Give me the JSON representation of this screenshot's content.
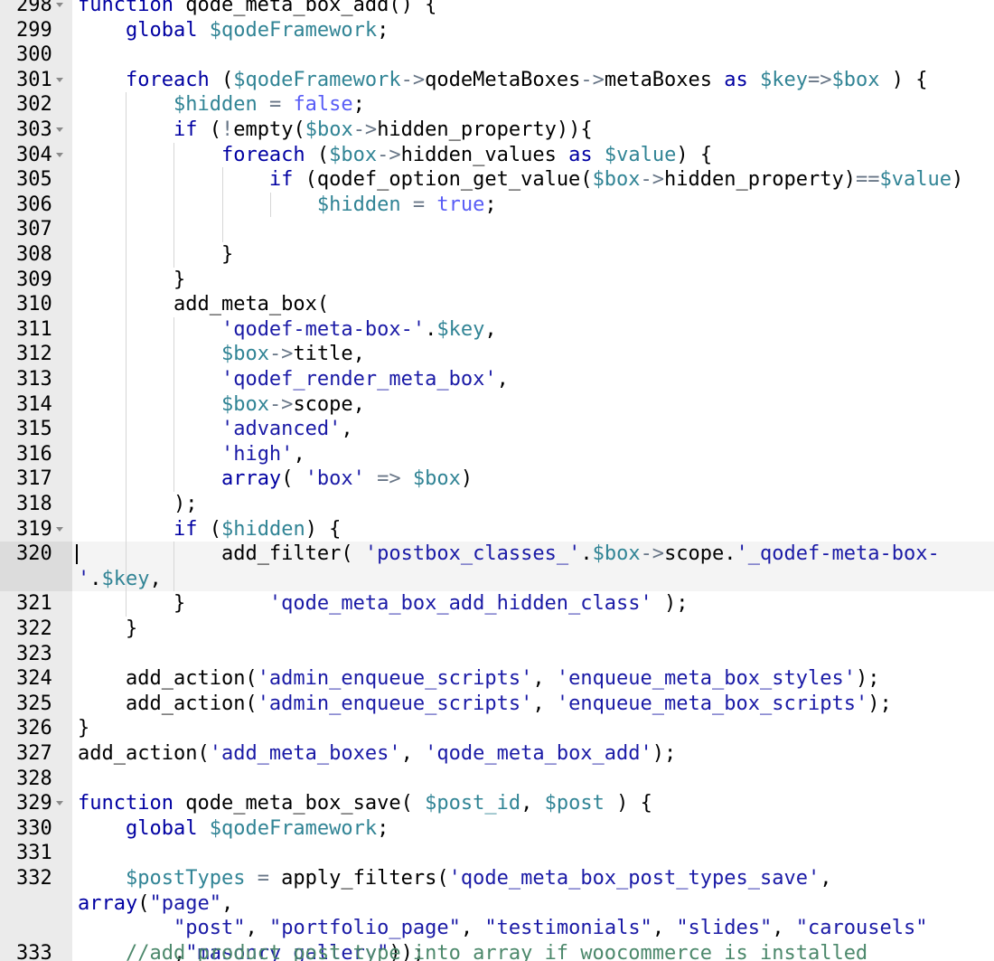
{
  "editor": {
    "colors": {
      "keyword": "#0000a2",
      "variable": "#318495",
      "string": "#1a1aa6",
      "comment": "#4c886b",
      "language_constant": "#585cf6",
      "operator": "#687687",
      "text": "#000000",
      "gutter_bg": "#ebebeb",
      "active_line_bg": "#f4f4f4"
    },
    "icons": {
      "fold": "fold-arrow-icon",
      "cursor": "text-cursor"
    },
    "active_line": "320",
    "lines": [
      {
        "n": "298",
        "fold": true,
        "tokens": [
          [
            "kw",
            "function"
          ],
          [
            "tx",
            " qode_meta_box_add() {"
          ]
        ]
      },
      {
        "n": "299",
        "tokens": [
          [
            "tx",
            "    "
          ],
          [
            "kw",
            "global"
          ],
          [
            "tx",
            " "
          ],
          [
            "vr",
            "$qodeFramework"
          ],
          [
            "tx",
            ";"
          ]
        ]
      },
      {
        "n": "300",
        "tokens": []
      },
      {
        "n": "301",
        "fold": true,
        "tokens": [
          [
            "tx",
            "    "
          ],
          [
            "kw",
            "foreach"
          ],
          [
            "tx",
            " ("
          ],
          [
            "vr",
            "$qodeFramework"
          ],
          [
            "op",
            "->"
          ],
          [
            "tx",
            "qodeMetaBoxes"
          ],
          [
            "op",
            "->"
          ],
          [
            "tx",
            "metaBoxes "
          ],
          [
            "kw",
            "as"
          ],
          [
            "tx",
            " "
          ],
          [
            "vr",
            "$key"
          ],
          [
            "op",
            "=>"
          ],
          [
            "vr",
            "$box"
          ],
          [
            "tx",
            " ) {"
          ]
        ]
      },
      {
        "n": "302",
        "tokens": [
          [
            "tx",
            "        "
          ],
          [
            "vr",
            "$hidden"
          ],
          [
            "tx",
            " "
          ],
          [
            "op",
            "="
          ],
          [
            "tx",
            " "
          ],
          [
            "lc",
            "false"
          ],
          [
            "tx",
            ";"
          ]
        ]
      },
      {
        "n": "303",
        "fold": true,
        "tokens": [
          [
            "tx",
            "        "
          ],
          [
            "kw",
            "if"
          ],
          [
            "tx",
            " ("
          ],
          [
            "op",
            "!"
          ],
          [
            "tx",
            "empty("
          ],
          [
            "vr",
            "$box"
          ],
          [
            "op",
            "->"
          ],
          [
            "tx",
            "hidden_property)){"
          ]
        ]
      },
      {
        "n": "304",
        "fold": true,
        "tokens": [
          [
            "tx",
            "            "
          ],
          [
            "kw",
            "foreach"
          ],
          [
            "tx",
            " ("
          ],
          [
            "vr",
            "$box"
          ],
          [
            "op",
            "->"
          ],
          [
            "tx",
            "hidden_values "
          ],
          [
            "kw",
            "as"
          ],
          [
            "tx",
            " "
          ],
          [
            "vr",
            "$value"
          ],
          [
            "tx",
            ") {"
          ]
        ]
      },
      {
        "n": "305",
        "tokens": [
          [
            "tx",
            "                "
          ],
          [
            "kw",
            "if"
          ],
          [
            "tx",
            " (qodef_option_get_value("
          ],
          [
            "vr",
            "$box"
          ],
          [
            "op",
            "->"
          ],
          [
            "tx",
            "hidden_property)"
          ],
          [
            "op",
            "=="
          ],
          [
            "vr",
            "$value"
          ],
          [
            "tx",
            ")"
          ]
        ]
      },
      {
        "n": "306",
        "tokens": [
          [
            "tx",
            "                    "
          ],
          [
            "vr",
            "$hidden"
          ],
          [
            "tx",
            " "
          ],
          [
            "op",
            "="
          ],
          [
            "tx",
            " "
          ],
          [
            "lc",
            "true"
          ],
          [
            "tx",
            ";"
          ]
        ]
      },
      {
        "n": "307",
        "tokens": []
      },
      {
        "n": "308",
        "tokens": [
          [
            "tx",
            "            }"
          ]
        ]
      },
      {
        "n": "309",
        "tokens": [
          [
            "tx",
            "        }"
          ]
        ]
      },
      {
        "n": "310",
        "tokens": [
          [
            "tx",
            "        add_meta_box("
          ]
        ]
      },
      {
        "n": "311",
        "tokens": [
          [
            "tx",
            "            "
          ],
          [
            "st",
            "'qodef-meta-box-'"
          ],
          [
            "tx",
            "."
          ],
          [
            "vr",
            "$key"
          ],
          [
            "tx",
            ","
          ]
        ]
      },
      {
        "n": "312",
        "tokens": [
          [
            "tx",
            "            "
          ],
          [
            "vr",
            "$box"
          ],
          [
            "op",
            "->"
          ],
          [
            "tx",
            "title,"
          ]
        ]
      },
      {
        "n": "313",
        "tokens": [
          [
            "tx",
            "            "
          ],
          [
            "st",
            "'qodef_render_meta_box'"
          ],
          [
            "tx",
            ","
          ]
        ]
      },
      {
        "n": "314",
        "tokens": [
          [
            "tx",
            "            "
          ],
          [
            "vr",
            "$box"
          ],
          [
            "op",
            "->"
          ],
          [
            "tx",
            "scope,"
          ]
        ]
      },
      {
        "n": "315",
        "tokens": [
          [
            "tx",
            "            "
          ],
          [
            "st",
            "'advanced'"
          ],
          [
            "tx",
            ","
          ]
        ]
      },
      {
        "n": "316",
        "tokens": [
          [
            "tx",
            "            "
          ],
          [
            "st",
            "'high'"
          ],
          [
            "tx",
            ","
          ]
        ]
      },
      {
        "n": "317",
        "tokens": [
          [
            "tx",
            "            "
          ],
          [
            "kw",
            "array"
          ],
          [
            "tx",
            "( "
          ],
          [
            "st",
            "'box'"
          ],
          [
            "tx",
            " "
          ],
          [
            "op",
            "=>"
          ],
          [
            "tx",
            " "
          ],
          [
            "vr",
            "$box"
          ],
          [
            "tx",
            ")"
          ]
        ]
      },
      {
        "n": "318",
        "tokens": [
          [
            "tx",
            "        );"
          ]
        ]
      },
      {
        "n": "319",
        "fold": true,
        "tokens": [
          [
            "tx",
            "        "
          ],
          [
            "kw",
            "if"
          ],
          [
            "tx",
            " ("
          ],
          [
            "vr",
            "$hidden"
          ],
          [
            "tx",
            ") {"
          ]
        ]
      },
      {
        "n": "320",
        "wrap": true,
        "tokens": [
          [
            "tx",
            "            add_filter( "
          ],
          [
            "st",
            "'postbox_classes_'"
          ],
          [
            "tx",
            "."
          ],
          [
            "vr",
            "$box"
          ],
          [
            "op",
            "->"
          ],
          [
            "tx",
            "scope."
          ],
          [
            "st",
            "'_qodef-meta-box-'"
          ],
          [
            "tx",
            "."
          ],
          [
            "vr",
            "$key"
          ],
          [
            "tx",
            ",\n                "
          ],
          [
            "st",
            "'qode_meta_box_add_hidden_class'"
          ],
          [
            "tx",
            " );"
          ]
        ]
      },
      {
        "n": "321",
        "tokens": [
          [
            "tx",
            "        }"
          ]
        ]
      },
      {
        "n": "322",
        "tokens": [
          [
            "tx",
            "    }"
          ]
        ]
      },
      {
        "n": "323",
        "tokens": []
      },
      {
        "n": "324",
        "tokens": [
          [
            "tx",
            "    add_action("
          ],
          [
            "st",
            "'admin_enqueue_scripts'"
          ],
          [
            "tx",
            ", "
          ],
          [
            "st",
            "'enqueue_meta_box_styles'"
          ],
          [
            "tx",
            ");"
          ]
        ]
      },
      {
        "n": "325",
        "tokens": [
          [
            "tx",
            "    add_action("
          ],
          [
            "st",
            "'admin_enqueue_scripts'"
          ],
          [
            "tx",
            ", "
          ],
          [
            "st",
            "'enqueue_meta_box_scripts'"
          ],
          [
            "tx",
            ");"
          ]
        ]
      },
      {
        "n": "326",
        "tokens": [
          [
            "tx",
            "}"
          ]
        ]
      },
      {
        "n": "327",
        "tokens": [
          [
            "tx",
            "add_action("
          ],
          [
            "st",
            "'add_meta_boxes'"
          ],
          [
            "tx",
            ", "
          ],
          [
            "st",
            "'qode_meta_box_add'"
          ],
          [
            "tx",
            ");"
          ]
        ]
      },
      {
        "n": "328",
        "tokens": []
      },
      {
        "n": "329",
        "fold": true,
        "tokens": [
          [
            "kw",
            "function"
          ],
          [
            "tx",
            " qode_meta_box_save( "
          ],
          [
            "vr",
            "$post_id"
          ],
          [
            "tx",
            ", "
          ],
          [
            "vr",
            "$post"
          ],
          [
            "tx",
            " ) {"
          ]
        ]
      },
      {
        "n": "330",
        "tokens": [
          [
            "tx",
            "    "
          ],
          [
            "kw",
            "global"
          ],
          [
            "tx",
            " "
          ],
          [
            "vr",
            "$qodeFramework"
          ],
          [
            "tx",
            ";"
          ]
        ]
      },
      {
        "n": "331",
        "tokens": []
      },
      {
        "n": "332",
        "wrap": true,
        "tokens": [
          [
            "tx",
            "    "
          ],
          [
            "vr",
            "$postTypes"
          ],
          [
            "tx",
            " "
          ],
          [
            "op",
            "="
          ],
          [
            "tx",
            " apply_filters("
          ],
          [
            "st",
            "'qode_meta_box_post_types_save'"
          ],
          [
            "tx",
            ", "
          ],
          [
            "kw",
            "array"
          ],
          [
            "tx",
            "("
          ],
          [
            "st",
            "\"page\""
          ],
          [
            "tx",
            ",\n        "
          ],
          [
            "st",
            "\"post\""
          ],
          [
            "tx",
            ", "
          ],
          [
            "st",
            "\"portfolio_page\""
          ],
          [
            "tx",
            ", "
          ],
          [
            "st",
            "\"testimonials\""
          ],
          [
            "tx",
            ", "
          ],
          [
            "st",
            "\"slides\""
          ],
          [
            "tx",
            ", "
          ],
          [
            "st",
            "\"carousels\""
          ],
          [
            "tx",
            "\n        ,"
          ],
          [
            "st",
            "\"masonry_gallery\""
          ],
          [
            "tx",
            "));"
          ]
        ]
      },
      {
        "n": "333",
        "tokens": [
          [
            "tx",
            "    "
          ],
          [
            "cm",
            "//add product post type into array if woocommerce is installed"
          ]
        ]
      }
    ]
  }
}
